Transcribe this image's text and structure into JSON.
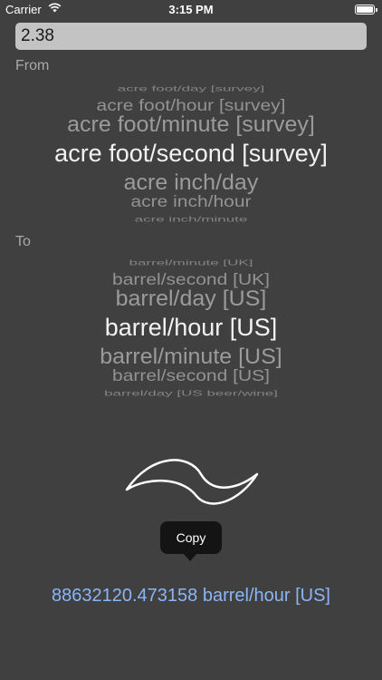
{
  "status_bar": {
    "carrier": "Carrier",
    "time": "3:15 PM"
  },
  "input": {
    "value": "2.38"
  },
  "from": {
    "label": "From",
    "items": [
      "acre foot/day [survey]",
      "acre foot/hour [survey]",
      "acre foot/minute [survey]",
      "acre foot/second [survey]",
      "acre inch/day",
      "acre inch/hour",
      "acre inch/minute"
    ],
    "selected_index": 3
  },
  "to": {
    "label": "To",
    "items": [
      "barrel/minute [UK]",
      "barrel/second [UK]",
      "barrel/day [US]",
      "barrel/hour [US]",
      "barrel/minute [US]",
      "barrel/second [US]",
      "barrel/day [US beer/wine]"
    ],
    "selected_index": 3
  },
  "tooltip": {
    "label": "Copy"
  },
  "result": {
    "text": "88632120.473158 barrel/hour [US]"
  },
  "colors": {
    "background": "#404040",
    "result": "#8ab6f7",
    "input_bg": "#c3c3c3"
  }
}
